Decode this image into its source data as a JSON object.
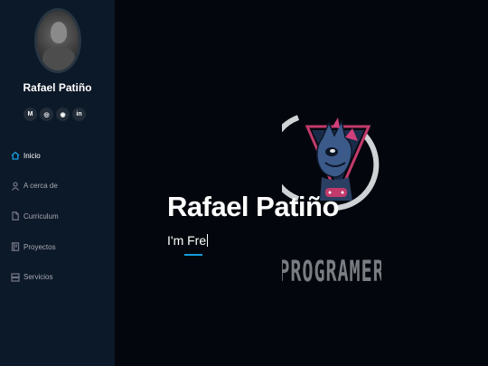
{
  "profile": {
    "name": "Rafael Patiño"
  },
  "socials": [
    {
      "icon": "gmail-icon",
      "glyph": "M"
    },
    {
      "icon": "whatsapp-icon",
      "glyph": "◎"
    },
    {
      "icon": "github-icon",
      "glyph": "◉"
    },
    {
      "icon": "linkedin-icon",
      "glyph": "in"
    }
  ],
  "nav": {
    "items": [
      {
        "label": "Inicio",
        "icon": "home-icon",
        "active": true
      },
      {
        "label": "A cerca de",
        "icon": "user-icon",
        "active": false
      },
      {
        "label": "Curriculum",
        "icon": "file-icon",
        "active": false
      },
      {
        "label": "Proyectos",
        "icon": "book-icon",
        "active": false
      },
      {
        "label": "Servicios",
        "icon": "server-icon",
        "active": false
      }
    ]
  },
  "hero": {
    "title": "Rafael Patiño",
    "subtitle": "I'm Fre",
    "logo_text": "PROGRAMER"
  },
  "colors": {
    "accent": "#149ddd",
    "sidebar_bg": "#0c1928",
    "main_bg": "#03070d"
  }
}
